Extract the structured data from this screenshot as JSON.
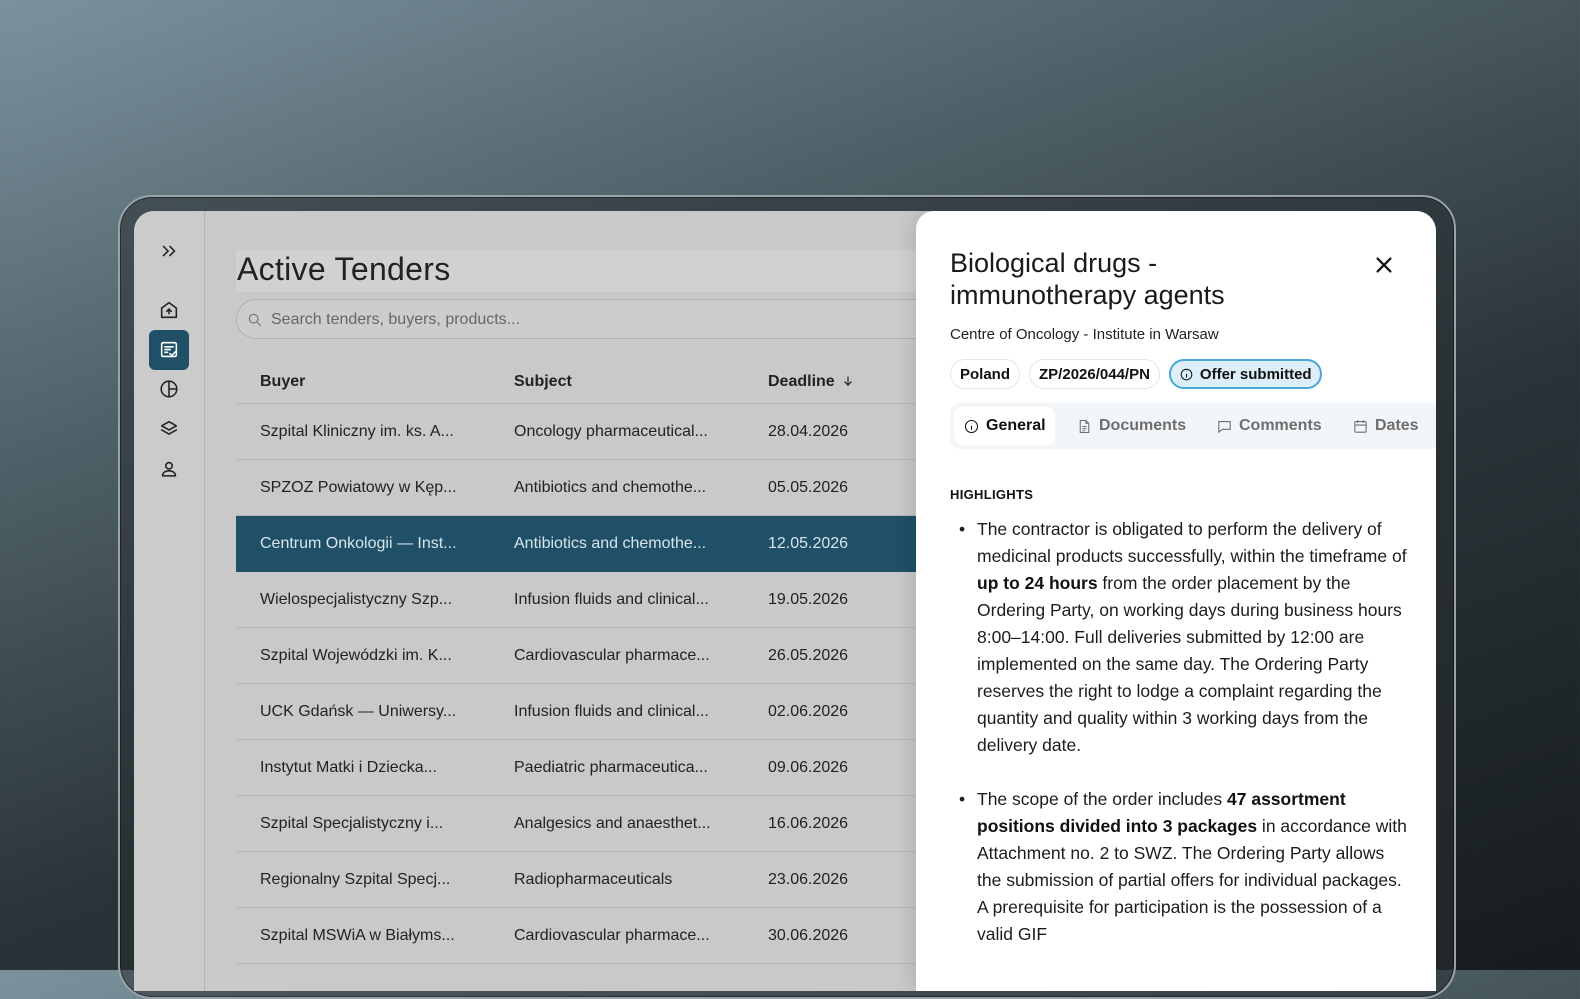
{
  "sidebar": {
    "items": [
      {
        "name": "expand",
        "icon": "chevrons-right-icon"
      },
      {
        "name": "home",
        "icon": "home-icon"
      },
      {
        "name": "tenders",
        "icon": "tenders-checklist-icon",
        "active": true
      },
      {
        "name": "analytics",
        "icon": "pie-chart-icon"
      },
      {
        "name": "layers",
        "icon": "layers-icon"
      },
      {
        "name": "profile",
        "icon": "user-icon"
      }
    ]
  },
  "main": {
    "title": "Active Tenders",
    "search_placeholder": "Search tenders, buyers, products...",
    "table": {
      "headers": {
        "buyer": "Buyer",
        "subject": "Subject",
        "deadline": "Deadline"
      },
      "sort": "deadline-descending-arrow",
      "rows": [
        {
          "buyer": "Szpital Kliniczny im. ks. A...",
          "subject": "Oncology pharmaceutical...",
          "deadline": "28.04.2026"
        },
        {
          "buyer": "SPZOZ Powiatowy w Kęp...",
          "subject": "Antibiotics and chemothe...",
          "deadline": "05.05.2026"
        },
        {
          "buyer": "Centrum Onkologii — Inst...",
          "subject": "Antibiotics and chemothe...",
          "deadline": "12.05.2026",
          "selected": true
        },
        {
          "buyer": "Wielospecjalistyczny Szp...",
          "subject": "Infusion fluids and clinical...",
          "deadline": "19.05.2026"
        },
        {
          "buyer": "Szpital Wojewódzki im. K...",
          "subject": "Cardiovascular pharmace...",
          "deadline": "26.05.2026"
        },
        {
          "buyer": "UCK Gdańsk — Uniwersy...",
          "subject": "Infusion fluids and clinical...",
          "deadline": "02.06.2026"
        },
        {
          "buyer": "Instytut Matki i Dziecka...",
          "subject": "Paediatric pharmaceutica...",
          "deadline": "09.06.2026"
        },
        {
          "buyer": "Szpital Specjalistyczny i...",
          "subject": "Analgesics and anaesthet...",
          "deadline": "16.06.2026"
        },
        {
          "buyer": "Regionalny Szpital Specj...",
          "subject": "Radiopharmaceuticals",
          "deadline": "23.06.2026"
        },
        {
          "buyer": "Szpital MSWiA w Białyms...",
          "subject": "Cardiovascular pharmace...",
          "deadline": "30.06.2026"
        }
      ]
    }
  },
  "detail": {
    "title_line1": "Biological drugs -",
    "title_line2": "immunotherapy agents",
    "buyer": "Centre of Oncology - Institute in Warsaw",
    "chips": {
      "country": "Poland",
      "reference": "ZP/2026/044/PN",
      "status": "Offer submitted"
    },
    "tabs": [
      "General",
      "Documents",
      "Comments",
      "Dates"
    ],
    "active_tab": "General",
    "section_label": "HIGHLIGHTS",
    "highlights": [
      {
        "pre": "The contractor is obligated to perform the delivery of medicinal products successfully, within the timeframe of ",
        "bold": "up to 24 hours",
        "post": " from the order placement by the Ordering Party, on working days during business hours 8:00–14:00. Full deliveries submitted by 12:00 are implemented on the same day. The Ordering Party reserves the right to lodge a complaint regarding the quantity and quality within 3 working days from the delivery date."
      },
      {
        "pre": "The scope of the order includes ",
        "bold": "47 assortment positions divided into 3 packages",
        "post": " in accordance with Attachment no. 2 to SWZ. The Ordering Party allows the submission of partial offers for individual packages. A prerequisite for participation is the possession of a valid GIF"
      }
    ]
  },
  "colors": {
    "accent": "#1f5068",
    "status_border": "#4aa6d6",
    "status_bg": "#dceef8"
  }
}
